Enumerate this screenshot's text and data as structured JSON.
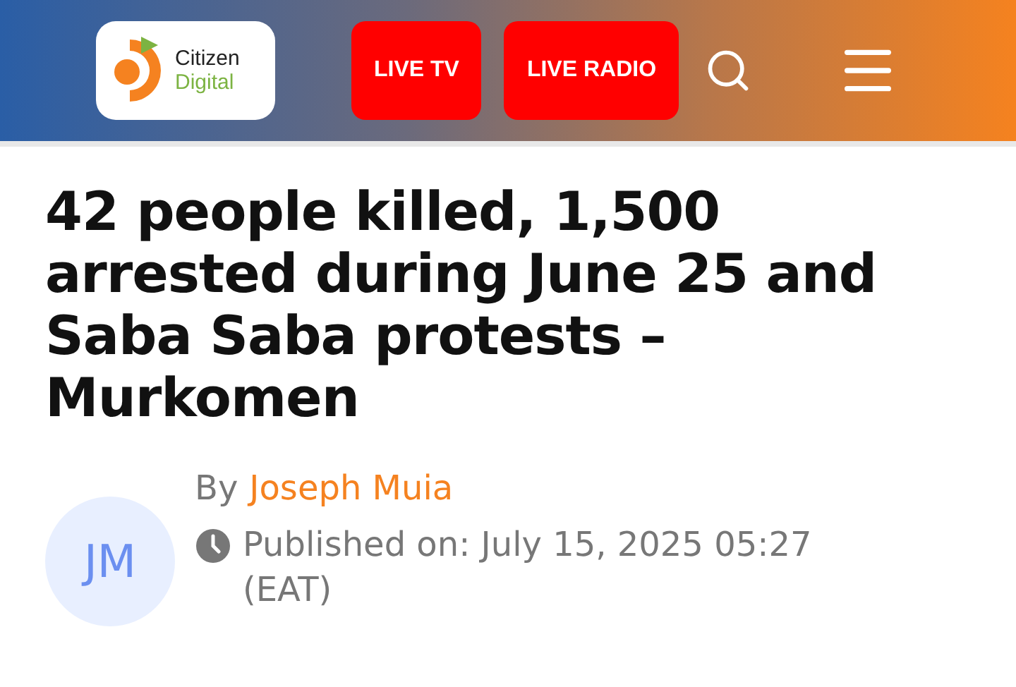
{
  "header": {
    "logo": {
      "line_1": "Citizen",
      "line_2": "Digital"
    },
    "buttons": [
      "LIVE TV",
      "LIVE RADIO"
    ]
  },
  "article": {
    "headline": "42 people killed, 1,500 arrested during June 25 and Saba Saba protests – Murkomen",
    "author": {
      "initials": "JM",
      "by": "By",
      "name": "Joseph Muia"
    },
    "published": "Published on: July 15, 2025 05:27 (EAT)"
  }
}
